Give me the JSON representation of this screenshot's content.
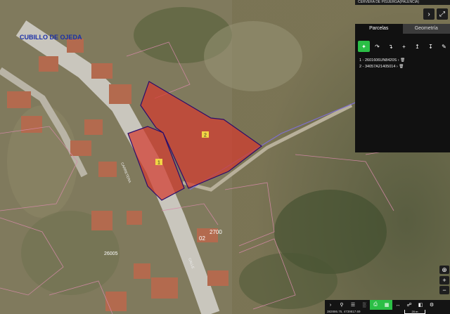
{
  "top_label": "CERVERA DE PISUERGA(PALENCIA)",
  "tabs": [
    {
      "label": "Parcelas"
    },
    {
      "label": "Geometría"
    }
  ],
  "parcels": [
    {
      "index": "1 -",
      "ref": "2601606UN8420S"
    },
    {
      "index": "2 -",
      "ref": "34057A21405014"
    }
  ],
  "map_labels": {
    "town": "CUBILLO DE OJEDA",
    "p1": "1",
    "p2": "2",
    "street1": "CARRETERA",
    "street2": "CALLE",
    "n2700": "2700",
    "n02": "02",
    "n26005": "26005"
  },
  "coords": "382886.75, 4739817.69",
  "scale": "20 m",
  "icons": {
    "next": "chevron-right-icon",
    "expand": "expand-icon",
    "delete": "trash-icon"
  },
  "colors": {
    "parcel_fill": "#d23b2f",
    "parcel_border": "#2b0d6b",
    "accent": "#2bbf46"
  }
}
